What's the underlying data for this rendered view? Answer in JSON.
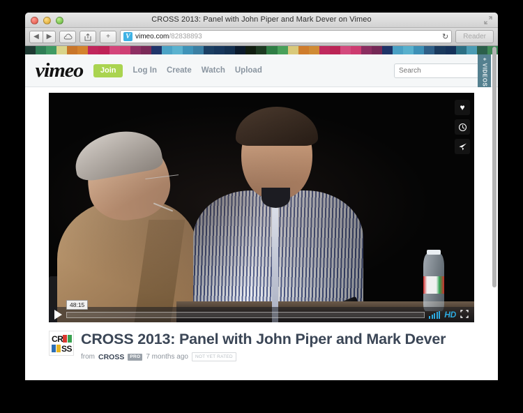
{
  "window": {
    "title": "CROSS 2013: Panel with John Piper and Mark Dever on Vimeo",
    "traffic_lights": [
      "close",
      "minimize",
      "zoom"
    ],
    "fullscreen_icon": "fullscreen-arrows-icon"
  },
  "toolbar": {
    "back_icon": "◀",
    "forward_icon": "▶",
    "cloud_icon": "☁",
    "share_icon": "↱",
    "add_tab_label": "+",
    "favicon_letter": "V",
    "url_domain": "vimeo.com",
    "url_path": "/82838893",
    "reload_icon": "↻",
    "reader_label": "Reader"
  },
  "site_header": {
    "logo": "vimeo",
    "join_label": "Join",
    "nav": [
      {
        "label": "Log In"
      },
      {
        "label": "Create"
      },
      {
        "label": "Watch"
      },
      {
        "label": "Upload"
      }
    ],
    "search": {
      "placeholder": "Search",
      "value": "",
      "icon": "search-icon"
    },
    "videos_tab_label": "+ VIDEOS"
  },
  "thumb_strip_colors": [
    "#1f3a33",
    "#2f7d55",
    "#3f9a63",
    "#d9d48a",
    "#c9762a",
    "#d4832e",
    "#c1265c",
    "#bf2257",
    "#d4457a",
    "#cf3f74",
    "#8e2f63",
    "#7a2a58",
    "#20356b",
    "#4ca3c6",
    "#5bb2cf",
    "#3f93b8",
    "#3b7fa3",
    "#1b3f63",
    "#17375c",
    "#133050",
    "#0b1a2c",
    "#111d10",
    "#1d3a22",
    "#2f7d45",
    "#49a05a",
    "#d9c97a",
    "#cf7d2c",
    "#d08b34",
    "#c02a5e",
    "#bb2455",
    "#d44a7d",
    "#cd3b70",
    "#8b2d60",
    "#742856",
    "#1e3468",
    "#4aa0c4",
    "#58b0cd",
    "#3d90b6",
    "#2f5f87",
    "#1a3a5e",
    "#15325a",
    "#2c6f84",
    "#4b9cb4",
    "#2b5f4a",
    "#3f8a57"
  ],
  "player": {
    "play_icon": "play-icon",
    "current_time": "48:15",
    "progress_percent": 0,
    "volume_level": 5,
    "hd_label": "HD",
    "fullscreen_icon": "fullscreen-icon",
    "overlay_actions": [
      {
        "name": "like-icon",
        "glyph": "♥"
      },
      {
        "name": "watch-later-icon",
        "glyph": "◴"
      },
      {
        "name": "share-icon",
        "glyph": "➤"
      }
    ],
    "scene": {
      "description": "Two men seated on a dark stage in conversation",
      "left_person": "older man in tan blazer with glasses and headset microphone",
      "right_person": "man in blue and white striped shirt holding a handheld microphone",
      "props": "plastic water bottle on a dark table"
    }
  },
  "video_info": {
    "thumbnail_logo": {
      "name": "cross-logo",
      "top_text": "CR",
      "bottom_text": "SS"
    },
    "title": "CROSS 2013: Panel with John Piper and Mark Dever",
    "from_label": "from",
    "owner": "CROSS",
    "pro_badge": "PRO",
    "uploaded": "7 months ago",
    "rating": "NOT YET RATED"
  },
  "colors": {
    "join_green": "#aad450",
    "title_slate": "#3b4656",
    "hd_blue": "#2eaae0",
    "videos_tab": "#54808f",
    "header_bg": "#f5f7f8"
  }
}
